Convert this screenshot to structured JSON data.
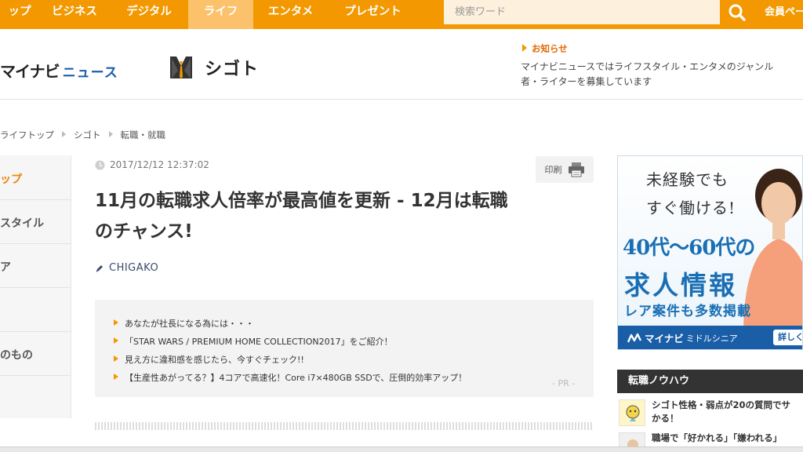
{
  "nav": {
    "items": [
      {
        "label": "ップ"
      },
      {
        "label": "ビジネス"
      },
      {
        "label": "デジタル"
      },
      {
        "label": "ライフ"
      },
      {
        "label": "エンタメ"
      },
      {
        "label": "プレゼント"
      }
    ],
    "active_index": 3,
    "search_placeholder": "検索ワード",
    "member_label": "会員ペー"
  },
  "header": {
    "logo_main": "マイナビ",
    "logo_sub": "ニュース",
    "section_logo": "シゴト",
    "notice_title": "お知らせ",
    "notice_line1": "マイナビニュースではライフスタイル・エンタメのジャンル",
    "notice_line2": "者・ライターを募集しています"
  },
  "breadcrumb": [
    "ライフトップ",
    "シゴト",
    "転職・就職"
  ],
  "leftnav": [
    "ップ",
    "スタイル",
    "ア",
    "",
    "のもの"
  ],
  "article": {
    "date": "2017/12/12 12:37:02",
    "print_label": "印刷",
    "title_line1": "11月の転職求人倍率が最高値を更新 - 12月は転職",
    "title_line2": "のチャンス!",
    "author": "CHIGAKO"
  },
  "pr": {
    "items": [
      "あなたが社長になる為には・・・",
      "「STAR WARS / PREMIUM HOME COLLECTION2017」をご紹介！",
      "見え方に違和感を感じたら、今すぐチェック!!",
      "【生産性あがってる？】4コアで高速化！Core i7×480GB SSDで、圧倒的効率アップ！"
    ],
    "label": "- PR -"
  },
  "ad": {
    "line1": "未経験でも",
    "line2": "すぐ働ける!",
    "line3": "40代～60代の",
    "line4": "求人情報",
    "line5": "レア案件も多数掲載",
    "brand": "マイナビ",
    "brand_sub": "ミドルシニア",
    "detail": "詳しく"
  },
  "knowhow": {
    "title": "転職ノウハウ",
    "items": [
      {
        "line1": "シゴト性格・弱点が20の質問でサ",
        "line2": "かる！"
      },
      {
        "line1": "職場で「好かれる」「嫌われる」",
        "line2": ""
      }
    ]
  },
  "colors": {
    "accent_orange": "#f39800",
    "brand_blue": "#1a5ea8"
  }
}
